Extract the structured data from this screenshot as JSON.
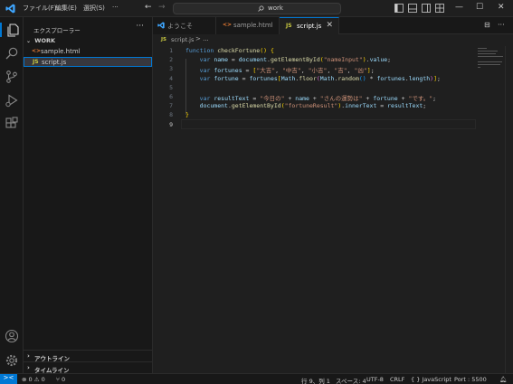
{
  "titlebar": {
    "menus": [
      "ファイル(F)",
      "編集(E)",
      "選択(S)",
      "···"
    ],
    "search_text": "work"
  },
  "sidebar": {
    "title": "エクスプローラー",
    "more": "···",
    "section": "WORK",
    "files": [
      {
        "icon": "<>",
        "name": "sample.html"
      },
      {
        "icon": "JS",
        "name": "script.js"
      }
    ],
    "bottom_sections": [
      "アウトライン",
      "タイムライン"
    ]
  },
  "tabs": [
    {
      "icon": "VS",
      "label": "ようこそ"
    },
    {
      "icon": "<>",
      "label": "sample.html"
    },
    {
      "icon": "JS",
      "label": "script.js",
      "close": "✕"
    }
  ],
  "breadcrumb": {
    "icon": "JS",
    "file": "script.js",
    "sep": "> ..."
  },
  "editor": {
    "line_numbers": [
      "1",
      "2",
      "3",
      "4",
      "5",
      "6",
      "7",
      "8",
      "9"
    ],
    "lines": [
      "function checkFortune() {",
      "    var name = document.getElementById(\"nameInput\").value;",
      "    var fortunes = [\"大吉\", \"中吉\", \"小吉\", \"吉\", \"凶\"];",
      "    var fortune = fortunes[Math.floor(Math.random() * fortunes.length)];",
      "",
      "    var resultText = \"今日の\" + name + \"さんの運勢は\" + fortune + \"です。\";",
      "    document.getElementById(\"fortuneResult\").innerText = resultText;",
      "}",
      ""
    ]
  },
  "statusbar": {
    "remote": "><",
    "problems": "⊗ 0 ⚠ 0",
    "ports": "⑂ 0",
    "cursor": "行 9、列 1",
    "spaces": "スペース: 4",
    "encoding": "UTF-8",
    "eol": "CRLF",
    "language": "{ } JavaScript",
    "port": "Port : 5500"
  },
  "colors": {
    "accent": "#0078d4",
    "js_icon": "#cbcb41",
    "html_icon": "#e37933",
    "vscode_icon": "#3ea6ff"
  }
}
